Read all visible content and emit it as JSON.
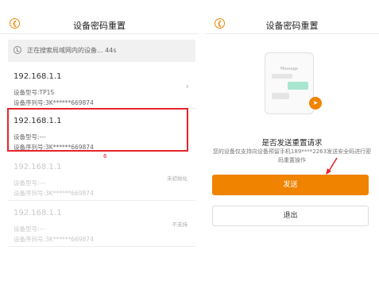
{
  "left": {
    "header": {
      "title": "设备密码重置",
      "back_icon": "back-icon"
    },
    "search": {
      "text": "正在搜索局域网内的设备... 44s",
      "icon": "loading-icon"
    },
    "devices": [
      {
        "ip": "192.168.1.1",
        "model": "设备型号:TP1S",
        "serial": "设备序列号:3K******669874",
        "status": "",
        "dimmed": false
      },
      {
        "ip": "192.168.1.1",
        "model": "设备型号:---",
        "serial": "设备序列号:3K******669874",
        "status": "",
        "dimmed": false
      },
      {
        "ip": "192.168.1.1",
        "model": "设备型号:---",
        "serial": "设备序列号:3K******669874",
        "status": "未初始化",
        "dimmed": true
      },
      {
        "ip": "192.168.1.1",
        "model": "设备型号:---",
        "serial": "设备序列号:3K******669874",
        "status": "不支持",
        "dimmed": true
      }
    ],
    "annotation": "6"
  },
  "right": {
    "header": {
      "title": "设备密码重置",
      "back_icon": "back-icon"
    },
    "illustration": {
      "message_label": "Message"
    },
    "question": "是否发送重置请求",
    "description": "您的设备仅支持向设备预留手机189****2263发送安全码进行密码重置操作",
    "send_label": "发送",
    "exit_label": "退出"
  },
  "colors": {
    "accent": "#f08300",
    "annotation": "#e8242b"
  }
}
